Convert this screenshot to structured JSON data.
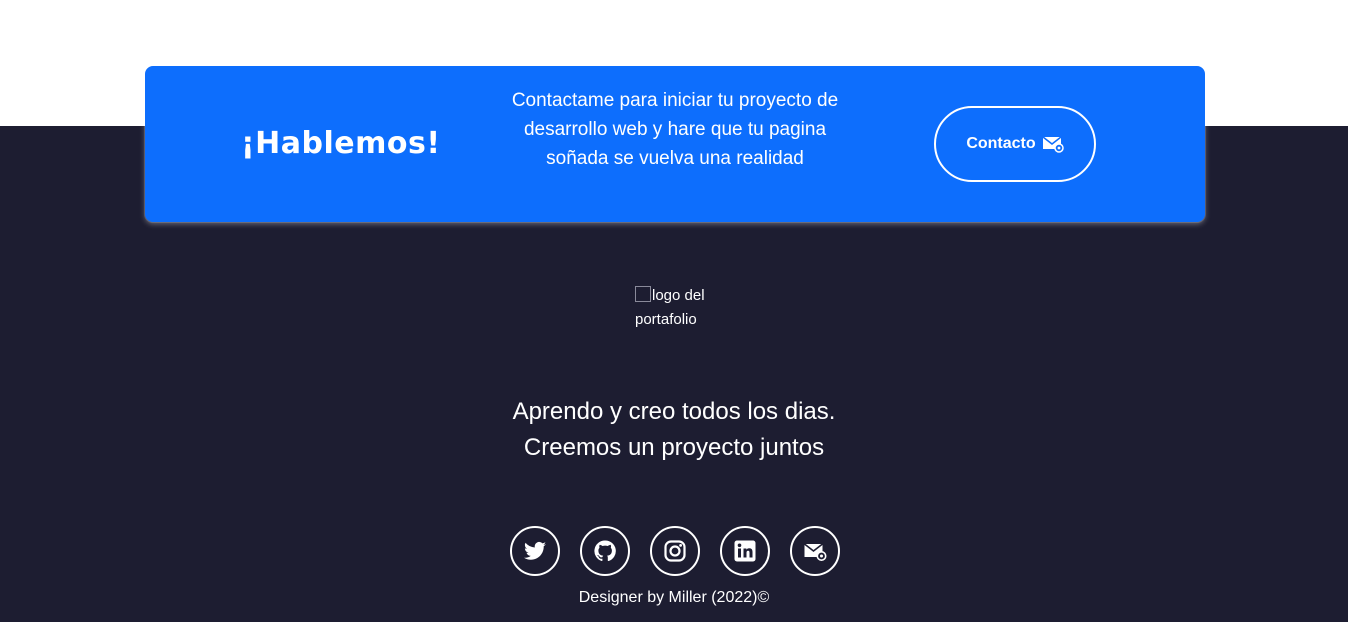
{
  "cta": {
    "title": "¡Hablemos!",
    "text": "Contactame para iniciar tu proyecto de desarrollo web y hare que tu pagina soñada se vuelva una realidad",
    "button_label": "Contacto",
    "button_icon": "mail-icon"
  },
  "logo": {
    "alt": "logo del portafolio"
  },
  "tagline": {
    "line1": "Aprendo y creo todos los dias.",
    "line2": "Creemos un proyecto juntos"
  },
  "social": [
    {
      "name": "twitter",
      "icon": "twitter-icon"
    },
    {
      "name": "github",
      "icon": "github-icon"
    },
    {
      "name": "instagram",
      "icon": "instagram-icon"
    },
    {
      "name": "linkedin",
      "icon": "linkedin-icon"
    },
    {
      "name": "email",
      "icon": "email-icon"
    }
  ],
  "credits": "Designer by Miller (2022)©",
  "colors": {
    "accent": "#0d6efd",
    "footer_bg": "#1d1d31",
    "text": "#ffffff"
  }
}
